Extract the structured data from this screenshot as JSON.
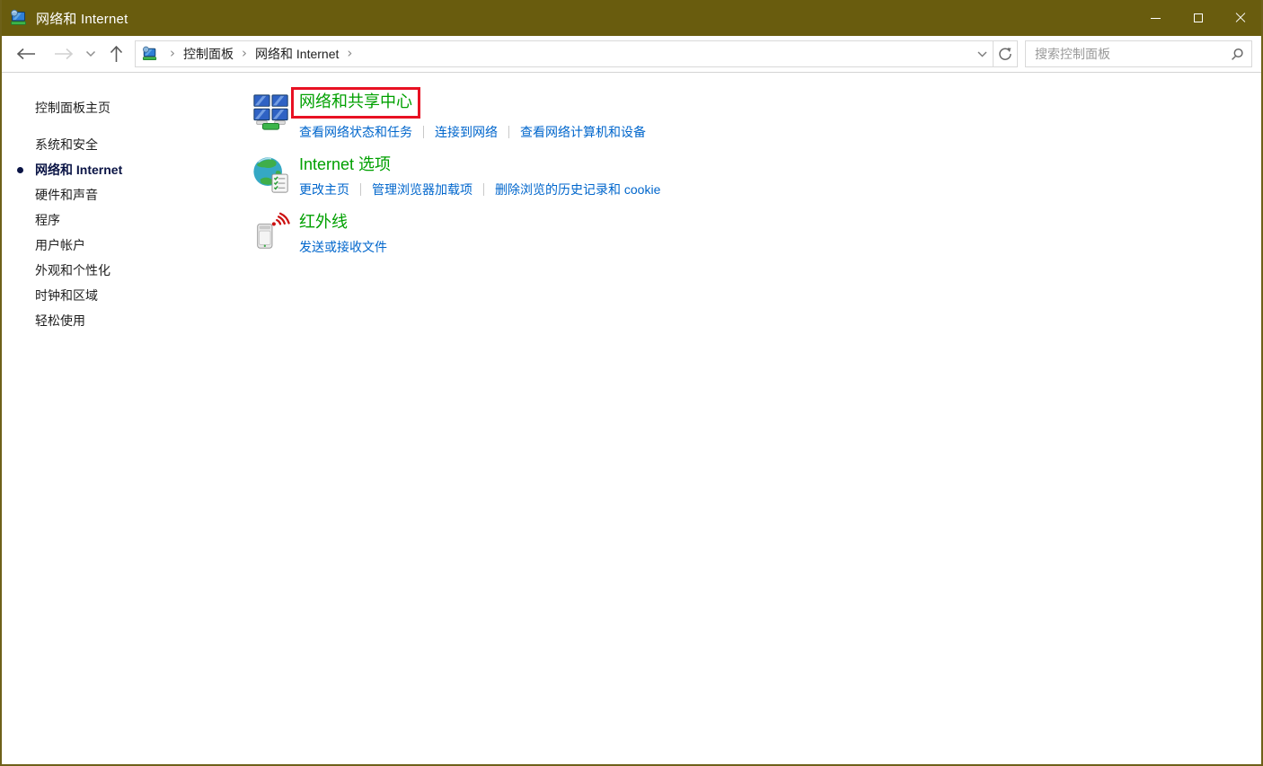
{
  "window": {
    "title": "网络和 Internet"
  },
  "toolbar": {
    "breadcrumb": {
      "items": [
        {
          "label": "控制面板"
        },
        {
          "label": "网络和 Internet"
        }
      ]
    },
    "search": {
      "placeholder": "搜索控制面板",
      "value": ""
    }
  },
  "sidebar": {
    "items": [
      {
        "label": "控制面板主页"
      },
      {
        "label": "系统和安全"
      },
      {
        "label": "网络和 Internet",
        "active": true
      },
      {
        "label": "硬件和声音"
      },
      {
        "label": "程序"
      },
      {
        "label": "用户帐户"
      },
      {
        "label": "外观和个性化"
      },
      {
        "label": "时钟和区域"
      },
      {
        "label": "轻松使用"
      }
    ]
  },
  "content": {
    "sections": [
      {
        "icon": "network-sharing-center-icon",
        "title": "网络和共享中心",
        "highlighted": true,
        "links": [
          "查看网络状态和任务",
          "连接到网络",
          "查看网络计算机和设备"
        ]
      },
      {
        "icon": "internet-options-icon",
        "title": "Internet 选项",
        "links": [
          "更改主页",
          "管理浏览器加载项",
          "删除浏览的历史记录和 cookie"
        ]
      },
      {
        "icon": "infrared-icon",
        "title": "红外线",
        "links": [
          "发送或接收文件"
        ]
      }
    ]
  },
  "colors": {
    "titlebar_bg": "#695c0e",
    "section_title_green": "#00a000",
    "link_blue": "#0066cc",
    "highlight_red": "#e81123",
    "active_sidebar": "#0a1445"
  }
}
